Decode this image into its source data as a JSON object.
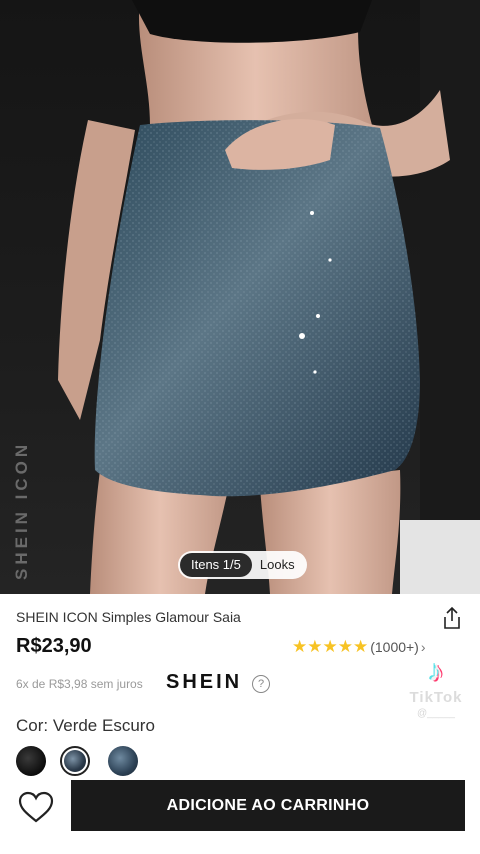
{
  "gallery": {
    "brand_vertical": "SHEIN ICON",
    "pager_active": "Itens 1/5",
    "pager_other": "Looks"
  },
  "product": {
    "title": "SHEIN ICON Simples Glamour Saia",
    "price": "R$23,90",
    "rating_stars": "★★★★★",
    "rating_count": "(1000+)",
    "rating_chevron": "›",
    "installments": "6x de R$3,98 sem juros",
    "brand_logo": "SHEIN",
    "help": "?",
    "color_label": "Cor: Verde Escuro"
  },
  "watermark": {
    "brand": "TikTok",
    "user": "@_____"
  },
  "icons": {
    "share": "share-icon",
    "heart": "heart-icon",
    "tiktok": "tiktok-icon"
  },
  "colors": {
    "accent_star": "#f7c324",
    "cart_button": "#1a1a1a"
  },
  "actions": {
    "add_to_cart": "ADICIONE AO CARRINHO"
  }
}
